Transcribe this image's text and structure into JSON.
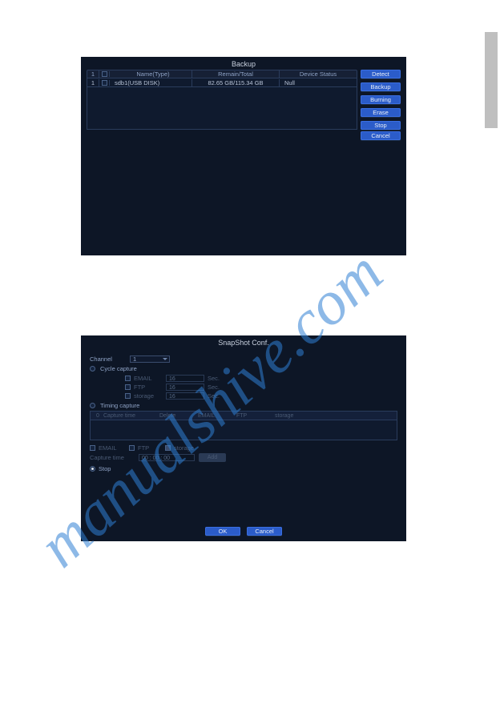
{
  "watermark_text": "manualshive.com",
  "backup_panel": {
    "title": "Backup",
    "columns": {
      "num": "1",
      "name_type": "Name(Type)",
      "remain_total": "Remain/Total",
      "device_status": "Device Status"
    },
    "row": {
      "num": "1",
      "name": "sdb1(USB DISK)",
      "remain_total": "82.65 GB/115.34 GB",
      "status": "Null"
    },
    "buttons": {
      "detect": "Detect",
      "backup": "Backup",
      "burning": "Burning",
      "erase": "Erase",
      "stop": "Stop"
    },
    "cancel": "Cancel"
  },
  "snapshot_panel": {
    "title": "SnapShot Conf.",
    "channel_label": "Channel",
    "channel_value": "1",
    "cycle_capture": "Cycle capture",
    "subs": {
      "email": {
        "label": "EMAIL",
        "value": "16",
        "unit": "Sec."
      },
      "ftp": {
        "label": "FTP",
        "value": "16",
        "unit": "Sec."
      },
      "storage": {
        "label": "storage",
        "value": "16",
        "unit": "Sec."
      }
    },
    "timing_capture": "Timing capture",
    "timing_head": {
      "c0": "0",
      "capture_time": "Capture time",
      "delete": "Delete",
      "email": "EMAIL",
      "ftp": "FTP",
      "storage": "storage"
    },
    "checks": {
      "email": "EMAIL",
      "ftp": "FTP",
      "storage": "storage"
    },
    "capture_time_label": "Capture time",
    "capture_time_value": "00 : 00 : 00",
    "add": "Add",
    "stop": "Stop",
    "ok": "OK",
    "cancel": "Cancel"
  }
}
